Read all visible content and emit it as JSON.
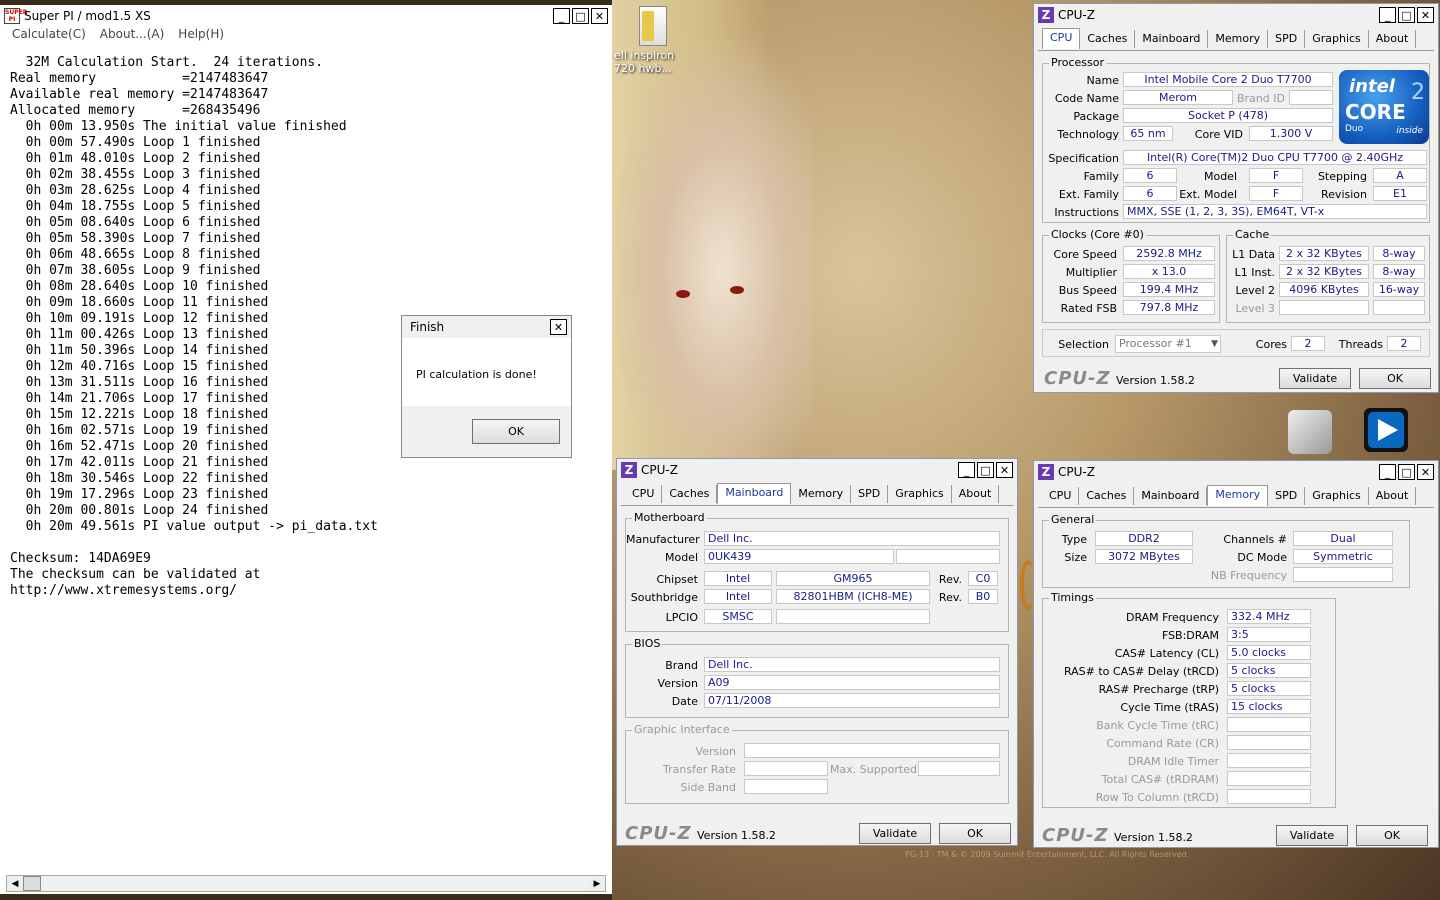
{
  "superpi": {
    "title": "Super PI / mod1.5 XS",
    "icon_text": "SUPER PI",
    "menu": [
      "Calculate(C)",
      "About...(A)",
      "Help(H)"
    ],
    "console_lines": [
      "  32M Calculation Start.  24 iterations.",
      "Real memory           =2147483647",
      "Available real memory =2147483647",
      "Allocated memory      =268435496",
      "  0h 00m 13.950s The initial value finished",
      "  0h 00m 57.490s Loop 1 finished",
      "  0h 01m 48.010s Loop 2 finished",
      "  0h 02m 38.455s Loop 3 finished",
      "  0h 03m 28.625s Loop 4 finished",
      "  0h 04m 18.755s Loop 5 finished",
      "  0h 05m 08.640s Loop 6 finished",
      "  0h 05m 58.390s Loop 7 finished",
      "  0h 06m 48.665s Loop 8 finished",
      "  0h 07m 38.605s Loop 9 finished",
      "  0h 08m 28.640s Loop 10 finished",
      "  0h 09m 18.660s Loop 11 finished",
      "  0h 10m 09.191s Loop 12 finished",
      "  0h 11m 00.426s Loop 13 finished",
      "  0h 11m 50.396s Loop 14 finished",
      "  0h 12m 40.716s Loop 15 finished",
      "  0h 13m 31.511s Loop 16 finished",
      "  0h 14m 21.706s Loop 17 finished",
      "  0h 15m 12.221s Loop 18 finished",
      "  0h 16m 02.571s Loop 19 finished",
      "  0h 16m 52.471s Loop 20 finished",
      "  0h 17m 42.011s Loop 21 finished",
      "  0h 18m 30.546s Loop 22 finished",
      "  0h 19m 17.296s Loop 23 finished",
      "  0h 20m 00.801s Loop 24 finished",
      "  0h 20m 49.561s PI value output -> pi_data.txt",
      "",
      "Checksum: 14DA69E9",
      "The checksum can be validated at",
      "http://www.xtremesystems.org/"
    ]
  },
  "finish": {
    "title": "Finish",
    "message": "PI calculation is done!",
    "ok": "OK"
  },
  "desktop": {
    "icon_label": "ell inspiron\n720 hwb...",
    "footer": "PG-13  ·  TM & © 2009 Summit Entertainment, LLC. All Rights Reserved."
  },
  "window_controls": {
    "minimize": "_",
    "maximize": "□",
    "close": "✕"
  },
  "cpuz_common": {
    "title": "CPU-Z",
    "icon": "Z",
    "tabs": [
      "CPU",
      "Caches",
      "Mainboard",
      "Memory",
      "SPD",
      "Graphics",
      "About"
    ],
    "brand": "CPU-Z",
    "version": "Version 1.58.2",
    "validate": "Validate",
    "ok": "OK"
  },
  "cpu": {
    "processor_group": "Processor",
    "name_label": "Name",
    "name": "Intel Mobile Core 2 Duo T7700",
    "codename_label": "Code Name",
    "codename": "Merom",
    "brandid_label": "Brand ID",
    "package_label": "Package",
    "package": "Socket P (478)",
    "technology_label": "Technology",
    "technology": "65 nm",
    "corevid_label": "Core VID",
    "corevid": "1.300 V",
    "spec_label": "Specification",
    "spec": "Intel(R) Core(TM)2 Duo CPU     T7700  @ 2.40GHz",
    "family_label": "Family",
    "family": "6",
    "model_label": "Model",
    "model": "F",
    "stepping_label": "Stepping",
    "stepping": "A",
    "extfamily_label": "Ext. Family",
    "extfamily": "6",
    "extmodel_label": "Ext. Model",
    "extmodel": "F",
    "revision_label": "Revision",
    "revision": "E1",
    "instructions_label": "Instructions",
    "instructions": "MMX, SSE (1, 2, 3, 3S), EM64T, VT-x",
    "clocks_group": "Clocks (Core #0)",
    "corespeed_label": "Core Speed",
    "corespeed": "2592.8 MHz",
    "multiplier_label": "Multiplier",
    "multiplier": "x 13.0",
    "busspeed_label": "Bus Speed",
    "busspeed": "199.4 MHz",
    "ratedfsb_label": "Rated FSB",
    "ratedfsb": "797.8 MHz",
    "cache_group": "Cache",
    "l1data_label": "L1 Data",
    "l1data": "2 x 32 KBytes",
    "l1data_way": "8-way",
    "l1inst_label": "L1 Inst.",
    "l1inst": "2 x 32 KBytes",
    "l1inst_way": "8-way",
    "l2_label": "Level 2",
    "l2": "4096 KBytes",
    "l2_way": "16-way",
    "l3_label": "Level 3",
    "selection_label": "Selection",
    "selection": "Processor #1",
    "cores_label": "Cores",
    "cores": "2",
    "threads_label": "Threads",
    "threads": "2",
    "logo": {
      "intel": "intel",
      "core": "CORE",
      "duo": "Duo",
      "inside": "inside",
      "two": "2"
    }
  },
  "mainboard": {
    "mb_group": "Motherboard",
    "manufacturer_label": "Manufacturer",
    "manufacturer": "Dell Inc.",
    "model_label": "Model",
    "model": "0UK439",
    "chipset_label": "Chipset",
    "chipset_vendor": "Intel",
    "chipset": "GM965",
    "chipset_rev_label": "Rev.",
    "chipset_rev": "C0",
    "southbridge_label": "Southbridge",
    "sb_vendor": "Intel",
    "sb": "82801HBM (ICH8-ME)",
    "sb_rev_label": "Rev.",
    "sb_rev": "B0",
    "lpcio_label": "LPCIO",
    "lpcio": "SMSC",
    "bios_group": "BIOS",
    "brand_label": "Brand",
    "brand": "Dell Inc.",
    "version_label": "Version",
    "version": "A09",
    "date_label": "Date",
    "date": "07/11/2008",
    "gi_group": "Graphic Interface",
    "gi_version_label": "Version",
    "gi_transfer_label": "Transfer Rate",
    "gi_max_label": "Max. Supported",
    "gi_sideband_label": "Side Band"
  },
  "memory": {
    "general_group": "General",
    "type_label": "Type",
    "type": "DDR2",
    "size_label": "Size",
    "size": "3072 MBytes",
    "channels_label": "Channels #",
    "channels": "Dual",
    "dcmode_label": "DC Mode",
    "dcmode": "Symmetric",
    "nbfreq_label": "NB Frequency",
    "timings_group": "Timings",
    "dram_freq_label": "DRAM Frequency",
    "dram_freq": "332.4 MHz",
    "fsb_dram_label": "FSB:DRAM",
    "fsb_dram": "3:5",
    "cl_label": "CAS# Latency (CL)",
    "cl": "5.0 clocks",
    "trcd_label": "RAS# to CAS# Delay (tRCD)",
    "trcd": "5 clocks",
    "trp_label": "RAS# Precharge (tRP)",
    "trp": "5 clocks",
    "tras_label": "Cycle Time (tRAS)",
    "tras": "15 clocks",
    "trc_label": "Bank Cycle Time (tRC)",
    "cr_label": "Command Rate (CR)",
    "idle_label": "DRAM Idle Timer",
    "trdram_label": "Total CAS# (tRDRAM)",
    "trcd2_label": "Row To Column (tRCD)"
  }
}
